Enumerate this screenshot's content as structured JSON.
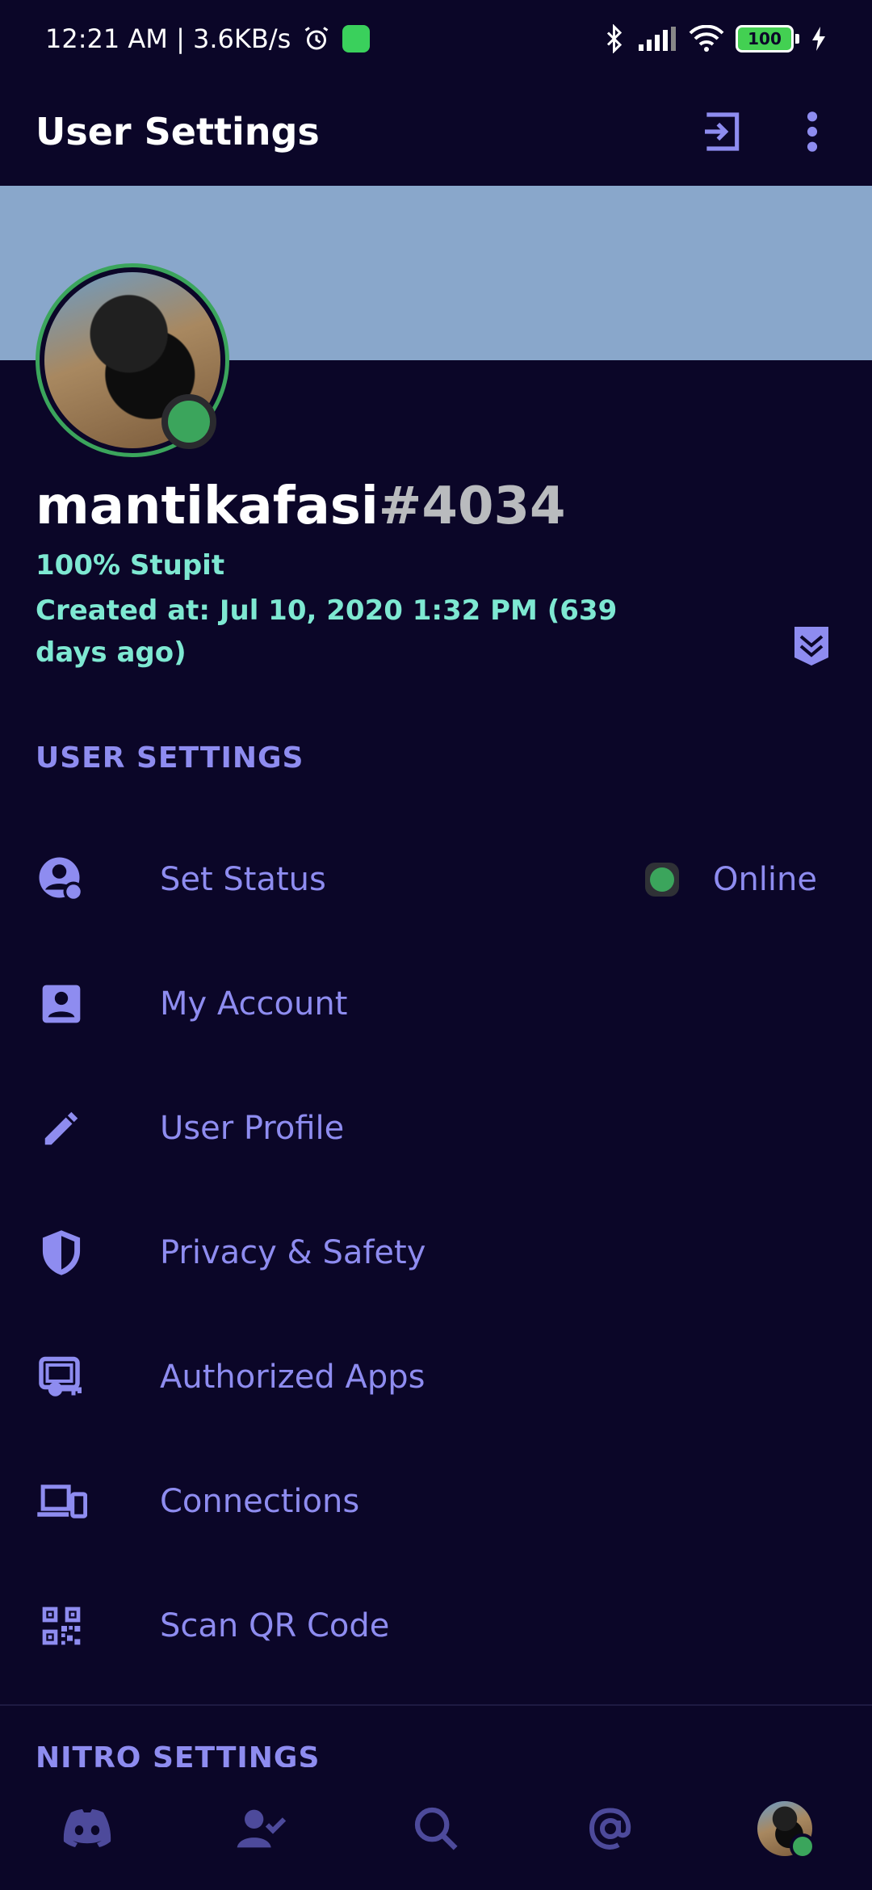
{
  "status_bar": {
    "time_speed": "12:21 AM | 3.6KB/s",
    "battery": "100"
  },
  "header": {
    "title": "User Settings"
  },
  "profile": {
    "username": "mantikafasi",
    "discriminator": "#4034",
    "bio": "100% Stupit",
    "created": "Created at: Jul 10, 2020 1:32 PM (639 days ago)",
    "status_color": "#3ba55c",
    "banner_color": "#89a7cb"
  },
  "sections": {
    "user_settings": "USER SETTINGS",
    "nitro_settings": "NITRO SETTINGS"
  },
  "menu": [
    {
      "label": "Set Status",
      "icon": "set-status-icon",
      "value": "Online"
    },
    {
      "label": "My Account",
      "icon": "account-icon"
    },
    {
      "label": "User Profile",
      "icon": "pencil-icon"
    },
    {
      "label": "Privacy & Safety",
      "icon": "shield-icon"
    },
    {
      "label": "Authorized Apps",
      "icon": "authorized-apps-icon"
    },
    {
      "label": "Connections",
      "icon": "connections-icon"
    },
    {
      "label": "Scan QR Code",
      "icon": "qr-code-icon"
    }
  ],
  "bottom_nav": [
    "discord-home-icon",
    "friends-icon",
    "search-icon",
    "mentions-icon",
    "profile-avatar"
  ],
  "colors": {
    "accent": "#8e8cf0",
    "background": "#0b0628",
    "teal": "#7ee8d2"
  }
}
